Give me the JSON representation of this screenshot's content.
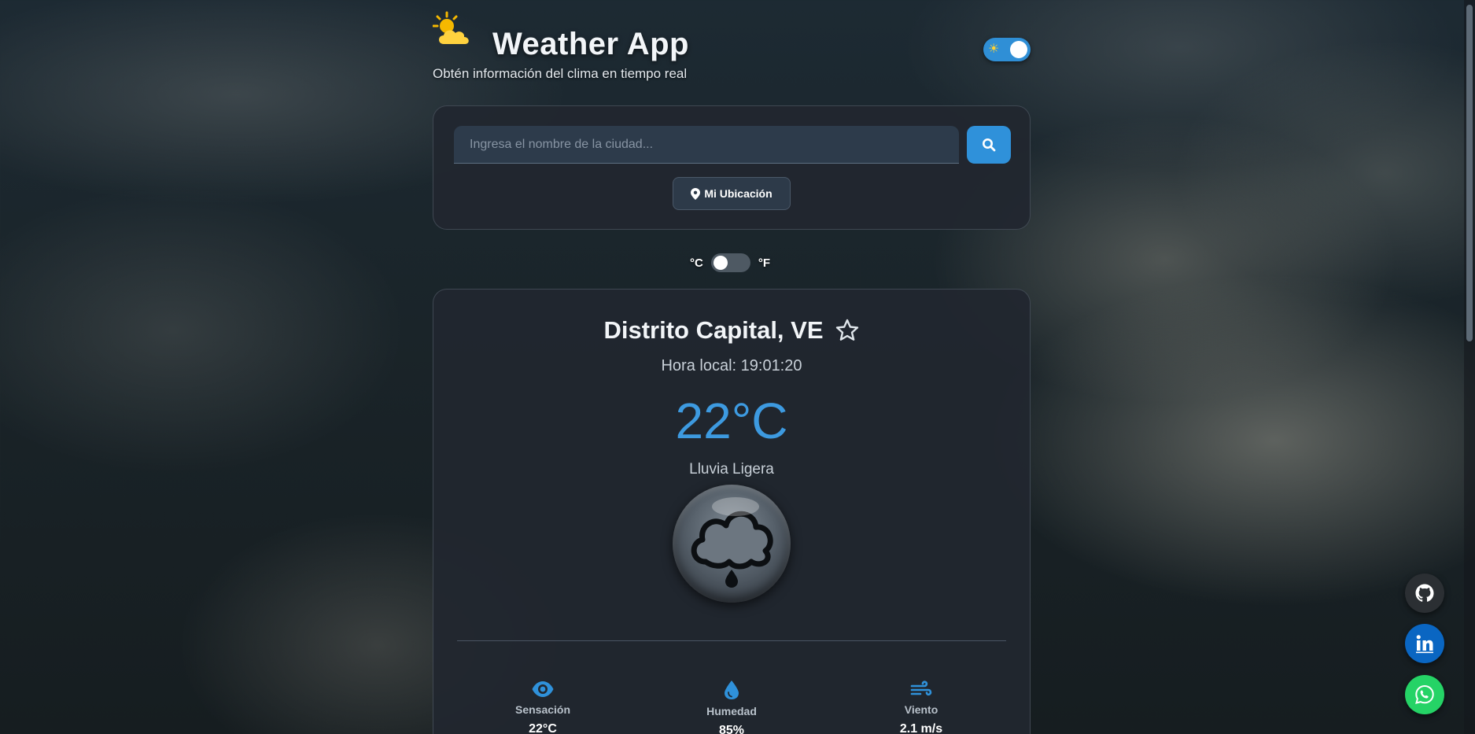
{
  "header": {
    "title": "Weather App",
    "subtitle": "Obtén información del clima en tiempo real",
    "logo_icon": "sun-behind-cloud-icon",
    "theme_toggle": {
      "icon": "sun-icon",
      "state": "on"
    }
  },
  "search": {
    "placeholder": "Ingresa el nombre de la ciudad...",
    "value": "",
    "button_icon": "search-icon",
    "location_button": {
      "icon": "map-pin-icon",
      "label": "Mi Ubicación"
    }
  },
  "units": {
    "celsius_label": "°C",
    "fahrenheit_label": "°F",
    "selected": "°C"
  },
  "weather": {
    "city": "Distrito Capital, VE",
    "favorite_icon": "star-outline-icon",
    "local_time": "Hora local: 19:01:20",
    "temperature": "22°C",
    "description": "Lluvia Ligera",
    "condition_icon": "rain-cloud-icon",
    "stats": [
      {
        "icon": "eye-icon",
        "label": "Sensación",
        "value": "22°C"
      },
      {
        "icon": "droplet-icon",
        "label": "Humedad",
        "value": "85%"
      },
      {
        "icon": "wind-icon",
        "label": "Viento",
        "value": "2.1 m/s"
      }
    ]
  },
  "social": [
    {
      "name": "github",
      "icon": "github-icon"
    },
    {
      "name": "linkedin",
      "icon": "linkedin-icon"
    },
    {
      "name": "whatsapp",
      "icon": "whatsapp-icon"
    }
  ],
  "colors": {
    "accent": "#2f91da",
    "temperature": "#3d9ae0",
    "card": "#21272f",
    "linkedin": "#0a66c2",
    "whatsapp": "#25d366",
    "github": "#2b2f33"
  }
}
